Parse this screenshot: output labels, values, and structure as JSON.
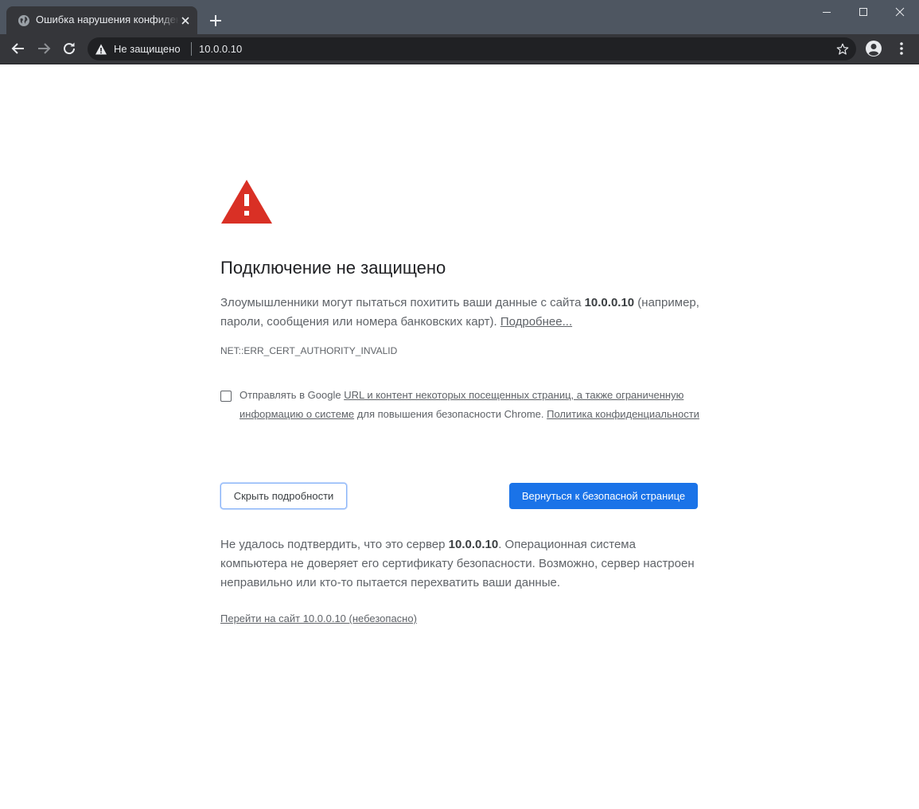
{
  "browser": {
    "tab_title": "Ошибка нарушения конфиденциальности",
    "omnibox_status": "Не защищено",
    "url": "10.0.0.10"
  },
  "page": {
    "heading": "Подключение не защищено",
    "p1_before": "Злоумышленники могут пытаться похитить ваши данные с сайта ",
    "p1_host": "10.0.0.10",
    "p1_after": " (например, пароли, сообщения или номера банковских карт). ",
    "p1_link": "Подробнее...",
    "error_code": "NET::ERR_CERT_AUTHORITY_INVALID",
    "opt_in": {
      "checked": false,
      "text_start": "Отправлять в Google ",
      "link1": "URL и контент некоторых посещенных страниц, а также ограниченную информацию о системе",
      "text_mid": " для повышения безопасности Chrome. ",
      "link2": "Политика конфиденциальности"
    },
    "details_button": "Скрыть подробности",
    "back_button": "Вернуться к безопасной странице",
    "p2_before": "Не удалось подтвердить, что это сервер ",
    "p2_host": "10.0.0.10",
    "p2_after": ". Операционная система компьютера не доверяет его сертификату безопасности. Возможно, сервер настроен неправильно или кто-то пытается перехватить ваши данные.",
    "proceed_link": "Перейти на сайт 10.0.0.10 (небезопасно)"
  },
  "colors": {
    "primary": "#1a73e8",
    "warning": "#d93025",
    "text": "#5f6368"
  }
}
